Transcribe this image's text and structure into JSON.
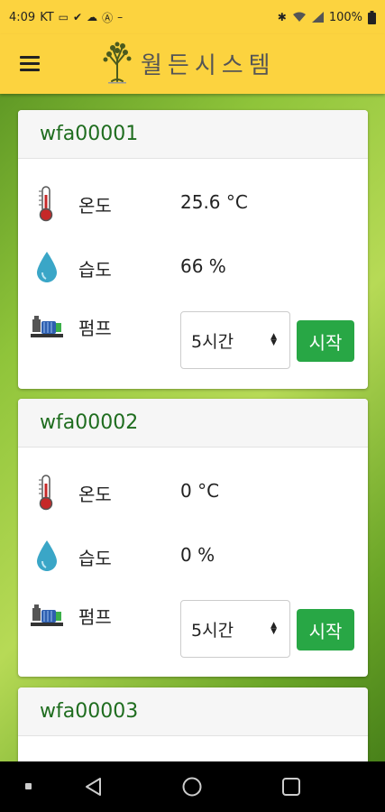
{
  "status_bar": {
    "time": "4:09",
    "carrier": "KT",
    "battery": "100%"
  },
  "header": {
    "title": "월든시스템"
  },
  "devices": [
    {
      "id": "wfa00001",
      "temperature": {
        "label": "온도",
        "value": "25.6 °C"
      },
      "humidity": {
        "label": "습도",
        "value": "66 %"
      },
      "pump": {
        "label": "펌프",
        "duration": "5시간",
        "start_label": "시작"
      }
    },
    {
      "id": "wfa00002",
      "temperature": {
        "label": "온도",
        "value": "0 °C"
      },
      "humidity": {
        "label": "습도",
        "value": "0 %"
      },
      "pump": {
        "label": "펌프",
        "duration": "5시간",
        "start_label": "시작"
      }
    },
    {
      "id": "wfa00003"
    }
  ],
  "colors": {
    "header_bg": "#fcd33f",
    "title_green": "#1f6d1f",
    "start_button": "#28a745"
  },
  "icons": [
    "menu-icon",
    "tree-logo-icon",
    "thermometer-icon",
    "water-drop-icon",
    "pump-icon",
    "back-icon",
    "home-icon",
    "recents-icon"
  ]
}
